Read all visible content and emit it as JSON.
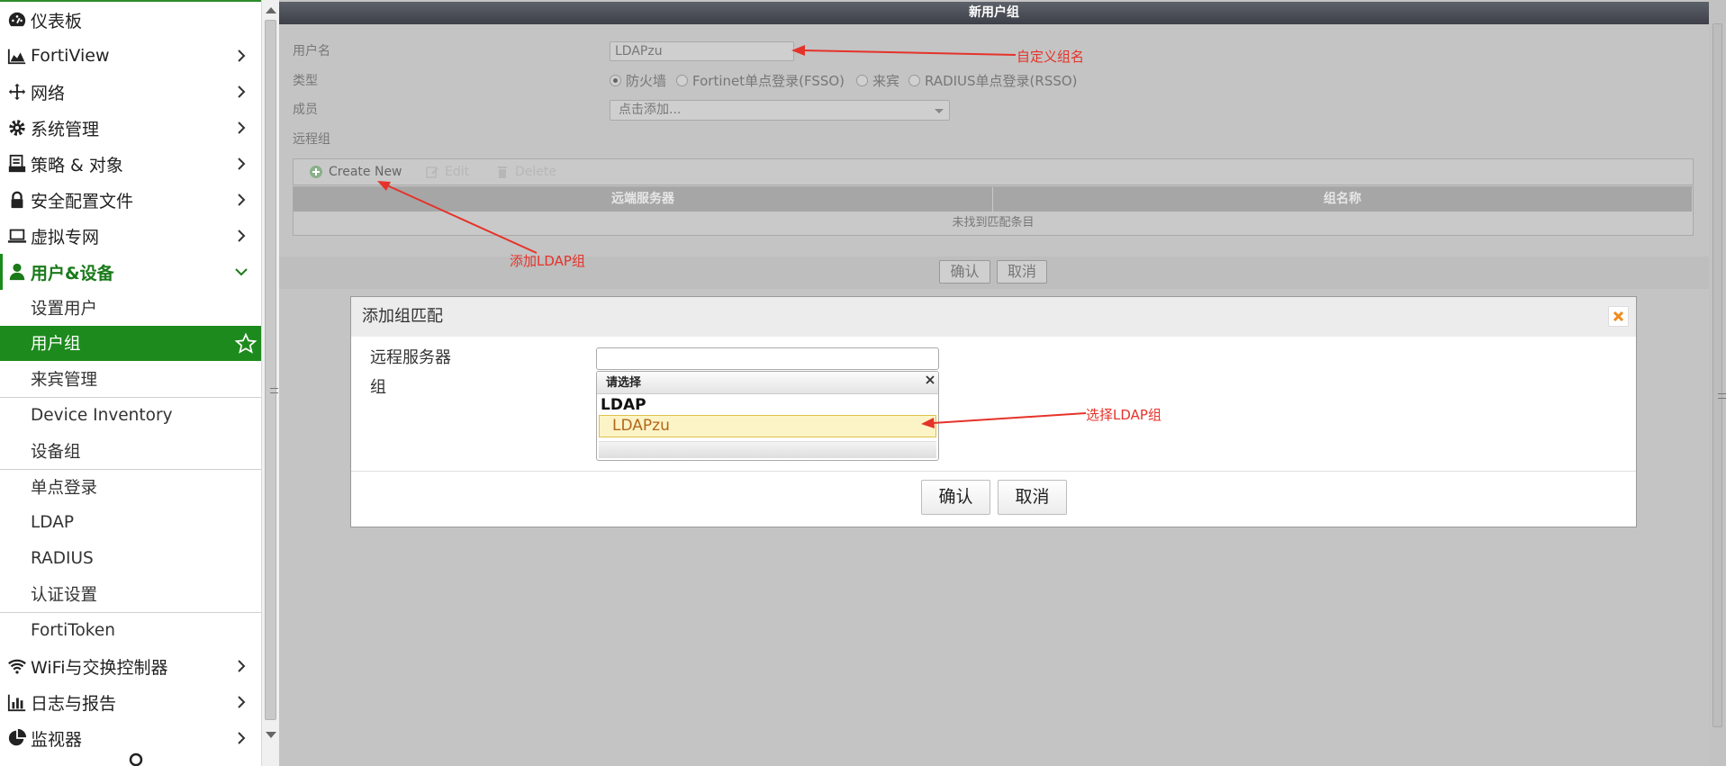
{
  "sidebar": {
    "items": [
      {
        "label": "仪表板",
        "icon": "dashboard-icon"
      },
      {
        "label": "FortiView",
        "icon": "area-chart-icon"
      },
      {
        "label": "网络",
        "icon": "network-arrows-icon"
      },
      {
        "label": "系统管理",
        "icon": "gear-icon"
      },
      {
        "label": "策略 & 对象",
        "icon": "policy-icon"
      },
      {
        "label": "安全配置文件",
        "icon": "lock-icon"
      },
      {
        "label": "虚拟专网",
        "icon": "laptop-icon"
      },
      {
        "label": "用户&设备",
        "icon": "user-icon"
      }
    ],
    "sub_items": [
      "设置用户",
      "用户组",
      "来宾管理",
      "Device Inventory",
      "设备组",
      "单点登录",
      "LDAP",
      "RADIUS",
      "认证设置",
      "FortiToken"
    ],
    "bottom_items": [
      {
        "label": "WiFi与交换控制器",
        "icon": "wifi-icon"
      },
      {
        "label": "日志与报告",
        "icon": "bar-chart-icon"
      },
      {
        "label": "监视器",
        "icon": "pie-chart-icon"
      }
    ]
  },
  "header": {
    "title": "新用户组"
  },
  "form": {
    "name_label": "用户名",
    "name_value": "LDAPzu",
    "type_label": "类型",
    "type_options": [
      "防火墙",
      "Fortinet单点登录(FSSO)",
      "来宾",
      "RADIUS单点登录(RSSO)"
    ],
    "type_selected": "防火墙",
    "member_label": "成员",
    "member_placeholder": "点击添加...",
    "remote_label": "远程组"
  },
  "toolbar": {
    "create_new": "Create New",
    "edit": "Edit",
    "delete": "Delete"
  },
  "table": {
    "columns": [
      "远端服务器",
      "组名称"
    ],
    "empty_text": "未找到匹配条目"
  },
  "buttons": {
    "ok": "确认",
    "cancel": "取消"
  },
  "annotations": {
    "custom_name": "自定义组名",
    "add_ldap": "添加LDAP组",
    "select_ldap": "选择LDAP组",
    "color": "#e5332a"
  },
  "dialog": {
    "title": "添加组匹配",
    "server_label": "远程服务器",
    "group_label": "组",
    "dropdown_header": "请选择",
    "dropdown_group": "LDAP",
    "dropdown_option": "LDAPzu",
    "ok": "确认",
    "cancel": "取消"
  },
  "colors": {
    "accent_green": "#1d8a1d",
    "header_dark": "#4a4d55",
    "highlight": "#fcf4c6"
  }
}
